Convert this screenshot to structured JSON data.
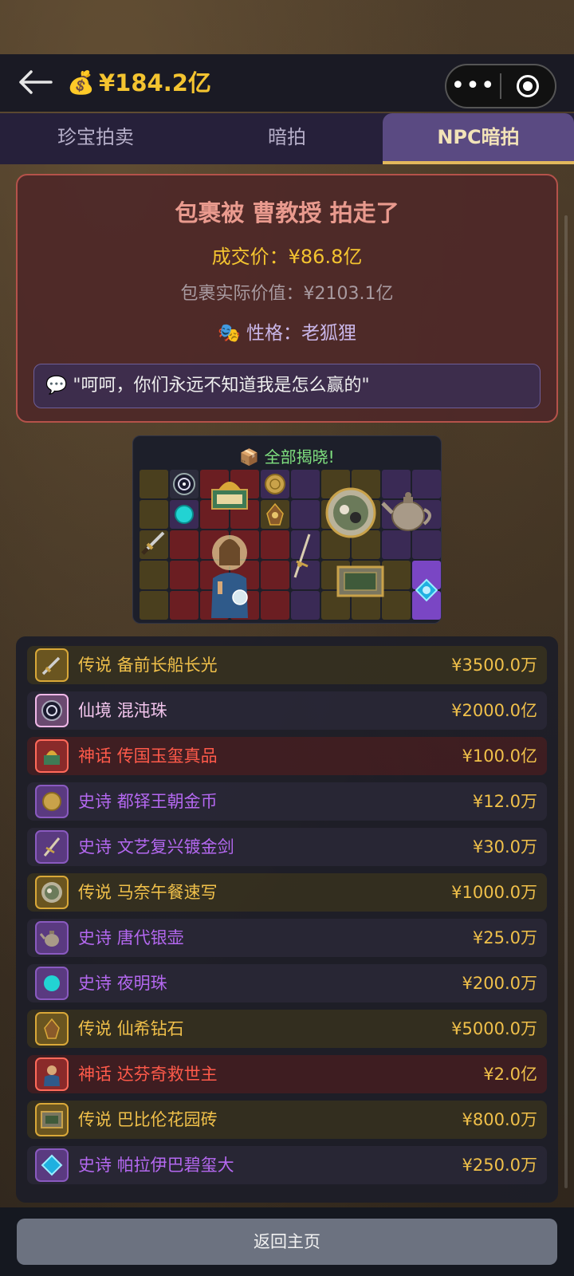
{
  "header": {
    "back_icon": "arrow-left-icon",
    "coin_icon": "money-bag-icon",
    "coin_emoji": "💰",
    "money": "¥184.2亿",
    "more_icon": "more-dots-icon",
    "more_glyph": "•••",
    "target_icon": "target-icon"
  },
  "tabs": [
    {
      "label": "珍宝拍卖"
    },
    {
      "label": "暗拍"
    },
    {
      "label": "NPC暗拍",
      "active": true
    }
  ],
  "result": {
    "title": "包裹被 曹教授 拍走了",
    "price": "成交价：¥86.8亿",
    "real_value": "包裹实际价值：¥2103.1亿",
    "persona_emoji": "🎭",
    "persona": "性格：老狐狸",
    "quote_emoji": "💬",
    "quote": "\"呵呵，你们永远不知道我是怎么赢的\""
  },
  "reveal": {
    "title_emoji": "📦",
    "title": "全部揭晓!"
  },
  "items": [
    {
      "rarity": "传说",
      "name": "备前长船长光",
      "price": "¥3500.0万",
      "icon": "sword-icon",
      "color": "#f0c04a"
    },
    {
      "rarity": "仙境",
      "name": "混沌珠",
      "price": "¥2000.0亿",
      "icon": "chaos-orb-icon",
      "color": "#f4c6ee"
    },
    {
      "rarity": "神话",
      "name": "传国玉玺真品",
      "price": "¥100.0亿",
      "icon": "jade-seal-icon",
      "color": "#ff5a4a"
    },
    {
      "rarity": "史诗",
      "name": "都铎王朝金币",
      "price": "¥12.0万",
      "icon": "gold-coin-icon",
      "color": "#b468f0"
    },
    {
      "rarity": "史诗",
      "name": "文艺复兴镀金剑",
      "price": "¥30.0万",
      "icon": "rapier-icon",
      "color": "#b468f0"
    },
    {
      "rarity": "传说",
      "name": "马奈午餐速写",
      "price": "¥1000.0万",
      "icon": "painting-plate-icon",
      "color": "#f0c04a"
    },
    {
      "rarity": "史诗",
      "name": "唐代银壶",
      "price": "¥25.0万",
      "icon": "teapot-icon",
      "color": "#b468f0"
    },
    {
      "rarity": "史诗",
      "name": "夜明珠",
      "price": "¥200.0万",
      "icon": "pearl-icon",
      "color": "#b468f0"
    },
    {
      "rarity": "传说",
      "name": "仙希钻石",
      "price": "¥5000.0万",
      "icon": "diamond-icon",
      "color": "#f0c04a"
    },
    {
      "rarity": "神话",
      "name": "达芬奇救世主",
      "price": "¥2.0亿",
      "icon": "salvator-mundi-icon",
      "color": "#ff5a4a"
    },
    {
      "rarity": "传说",
      "name": "巴比伦花园砖",
      "price": "¥800.0万",
      "icon": "tablet-icon",
      "color": "#f0c04a"
    },
    {
      "rarity": "史诗",
      "name": "帕拉伊巴碧玺大",
      "price": "¥250.0万",
      "icon": "blue-gem-icon",
      "color": "#b468f0"
    }
  ],
  "footer": {
    "home_button": "返回主页"
  }
}
